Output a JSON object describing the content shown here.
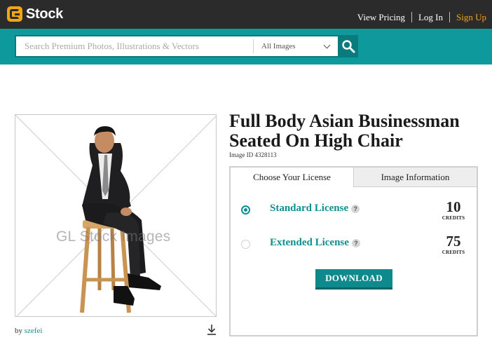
{
  "header": {
    "logo_text": "Stock",
    "nav": [
      {
        "label": "View Pricing"
      },
      {
        "label": "Log In"
      },
      {
        "label": "Sign Up"
      }
    ]
  },
  "search": {
    "placeholder": "Search Premium Photos, Illustrations & Vectors",
    "value": "",
    "filter_selected": "All Images"
  },
  "image": {
    "watermark": "GL Stock Images",
    "by_prefix": "by",
    "author": "szefei"
  },
  "detail": {
    "title": "Full Body Asian Businessman Seated On High Chair",
    "image_id_label": "Image ID 4328113"
  },
  "license_panel": {
    "tabs": [
      {
        "label": "Choose Your License",
        "active": true
      },
      {
        "label": "Image Information",
        "active": false
      }
    ],
    "options": [
      {
        "name": "Standard License",
        "help": "?",
        "credits": "10",
        "credits_unit": "CREDITS",
        "selected": true
      },
      {
        "name": "Extended License",
        "help": "?",
        "credits": "75",
        "credits_unit": "CREDITS",
        "selected": false
      }
    ],
    "download_label": "DOWNLOAD"
  },
  "colors": {
    "accent": "#0e9a9c",
    "brand_orange": "#f2a516",
    "topbar": "#2b2b2b"
  },
  "icons": [
    "logo-mark-icon",
    "chevron-down-icon",
    "search-icon",
    "download-icon",
    "help-icon"
  ]
}
